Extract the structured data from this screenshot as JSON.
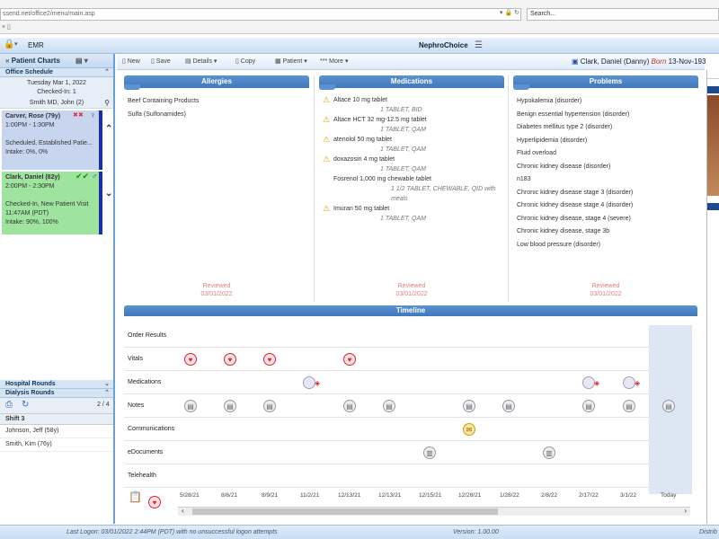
{
  "browser": {
    "url": "ssend.net/office2/menu/main.asp",
    "search_placeholder": "Search..."
  },
  "app": {
    "module": "EMR",
    "brand": "NephroChoice"
  },
  "sidebar": {
    "title": "Patient Charts",
    "office_schedule": "Office Schedule",
    "date": "Tuesday Mar 1, 2022",
    "checked_in": "Checked-In: 1",
    "provider": "Smith MD, John (2)",
    "appointments": [
      {
        "name": "Carver, Rose (79y)",
        "time": "1:00PM - 1:30PM",
        "status": "Scheduled, Established Patie...",
        "intake": "Intake: 0%, 0%"
      },
      {
        "name": "Clark, Daniel (82y)",
        "time": "2:00PM - 2:30PM",
        "status": "Checked-In, New Patient Visit",
        "checkin_time": "11:47AM (PDT)",
        "intake": "Intake: 90%, 100%"
      }
    ],
    "hospital_rounds": "Hospital Rounds",
    "dialysis_rounds": "Dialysis Rounds",
    "pager": "2 / 4",
    "shift": "Shift 3",
    "shift_patients": [
      "Johnson, Jeff (58y)",
      "Smith, Kim (76y)"
    ]
  },
  "toolbar": {
    "new": "New",
    "save": "Save",
    "details": "Details",
    "copy": "Copy",
    "patient": "Patient",
    "more": "*** More",
    "patient_name": "Clark, Daniel (Danny)",
    "born_label": "Born",
    "born_date": "13-Nov-193"
  },
  "allergies": {
    "title": "Allergies",
    "items": [
      "Beef Containing Products",
      "Sulfa (Sulfonamides)"
    ],
    "reviewed": "Reviewed",
    "reviewed_date": "03/01/2022"
  },
  "medications": {
    "title": "Medications",
    "items": [
      {
        "name": "Altace 10 mg tablet",
        "sig": "1 TABLET, BID"
      },
      {
        "name": "Altace HCT 32 mg-12.5 mg tablet",
        "sig": "1 TABLET, QAM"
      },
      {
        "name": "atenolol 50 mg tablet",
        "sig": "1 TABLET, QAM"
      },
      {
        "name": "doxazosin 4 mg tablet",
        "sig": "1 TABLET, QAM"
      },
      {
        "name": "Fosrenol 1,000 mg chewable tablet",
        "sig": "1 1/2 TABLET, CHEWABLE, QID with meals"
      },
      {
        "name": "Imuran 50 mg tablet",
        "sig": "1 TABLET, QAM"
      }
    ],
    "reviewed": "Reviewed",
    "reviewed_date": "03/01/2022"
  },
  "problems": {
    "title": "Problems",
    "items": [
      "Hypokalemia (disorder)",
      "Benign essential hypertension (disorder)",
      "Diabetes mellitus type 2 (disorder)",
      "Hyperlipidemia (disorder)",
      "Fluid overload",
      "Chronic kidney disease (disorder)",
      "n183",
      "Chronic kidney disease stage 3 (disorder)",
      "Chronic kidney disease stage 4 (disorder)",
      "Chronic kidney disease, stage 4 (severe)",
      "Chronic kidney disease, stage 3b",
      "Low blood pressure (disorder)"
    ],
    "reviewed": "Reviewed",
    "reviewed_date": "03/01/2022"
  },
  "timeline": {
    "title": "Timeline",
    "rows": [
      "Order Results",
      "Vitals",
      "Medications",
      "Notes",
      "Communications",
      "eDocuments",
      "Telehealth"
    ],
    "dates": [
      "5/28/21",
      "8/6/21",
      "8/9/21",
      "11/2/21",
      "12/13/21",
      "12/13/21",
      "12/15/21",
      "12/28/21",
      "1/28/22",
      "2/8/22",
      "2/17/22",
      "3/1/22",
      "Today"
    ]
  },
  "status": {
    "last_logon": "Last Logon: 03/01/2022 2:44PM (PDT) with no unsuccessful logon attempts",
    "version": "Version: 1.00.00",
    "right": "Distrib"
  }
}
